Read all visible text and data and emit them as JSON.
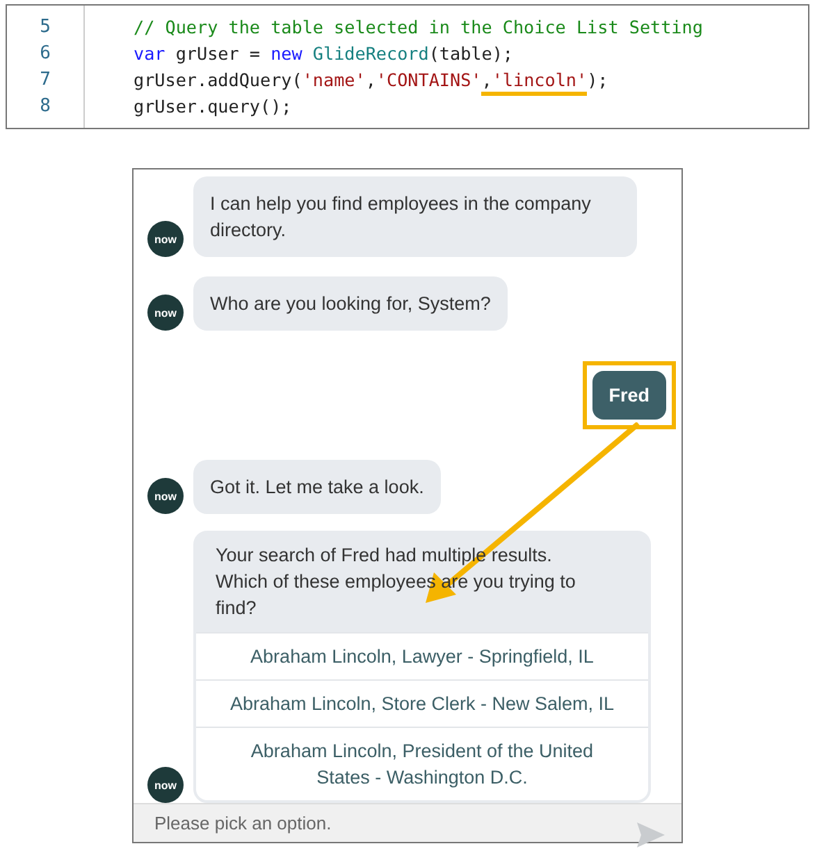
{
  "code": {
    "lines": [
      {
        "number": "5",
        "tokens": [
          {
            "kind": "comment",
            "text": "// Query the table selected in the Choice List Setting"
          }
        ]
      },
      {
        "number": "6",
        "tokens": [
          {
            "kind": "keyword",
            "text": "var"
          },
          {
            "kind": "plain",
            "text": " grUser = "
          },
          {
            "kind": "keyword",
            "text": "new "
          },
          {
            "kind": "class",
            "text": "GlideRecord"
          },
          {
            "kind": "plain",
            "text": "(table);"
          }
        ]
      },
      {
        "number": "7",
        "tokens": [
          {
            "kind": "plain",
            "text": "grUser.addQuery("
          },
          {
            "kind": "string",
            "text": "'name'"
          },
          {
            "kind": "plain",
            "text": ","
          },
          {
            "kind": "string",
            "text": "'CONTAINS'"
          },
          {
            "kind": "plain",
            "text": ",",
            "underlined": true
          },
          {
            "kind": "string",
            "text": "'lincoln'",
            "underlined": true
          },
          {
            "kind": "plain",
            "text": ");"
          }
        ]
      },
      {
        "number": "8",
        "tokens": [
          {
            "kind": "plain",
            "text": "grUser.query();"
          }
        ]
      }
    ]
  },
  "chat": {
    "messages": [
      {
        "kind": "bot",
        "avatar": "now",
        "text": "I can help you find employees in the company directory."
      },
      {
        "kind": "bot",
        "avatar": "now",
        "text": "Who are you looking for, System?"
      },
      {
        "kind": "user",
        "text": "Fred",
        "highlighted": true
      },
      {
        "kind": "bot",
        "avatar": "now",
        "text": "Got it. Let me take a look."
      },
      {
        "kind": "choice",
        "avatar": "now",
        "text": "Your search of Fred had multiple results. Which of these employees are you trying to find?",
        "options": [
          "Abraham Lincoln, Lawyer - Springfield, IL",
          "Abraham Lincoln, Store Clerk - New Salem, IL",
          "Abraham Lincoln, President of the United States - Washington D.C."
        ]
      }
    ],
    "input": {
      "placeholder": "Please pick an option."
    }
  }
}
